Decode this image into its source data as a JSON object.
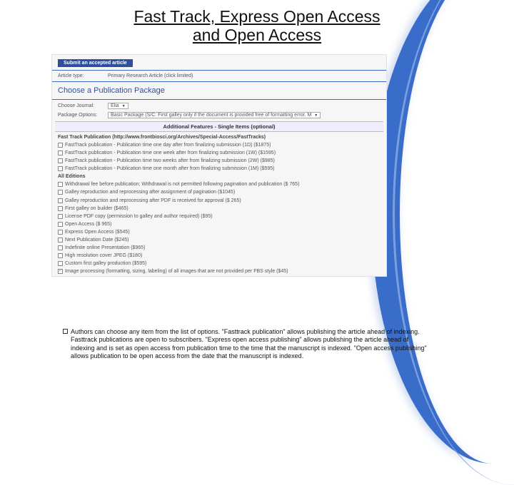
{
  "title_line1": "Fast Track, Express Open Access",
  "title_line2": "and Open Access",
  "panel": {
    "submit_label": "Submit an accepted article",
    "article_type_label": "Article type:",
    "article_type_value": "Primary Research Article (click limited)",
    "choose_package": "Choose a Publication Package",
    "choose_journal_label": "Choose Journal:",
    "choose_journal_value": "Elia",
    "package_options_label": "Package Options:",
    "package_options_value": "Basic Package (S/C: First galley only if the document is provided free of formatting error. M",
    "addl_header": "Additional Features - Single Items (optional)",
    "fast_track_header": "Fast Track Publication (http://www.frontbiosci.org/Archives/Special-Access/FastTracks)",
    "fast_track_items": [
      "FastTrack publication - Publication time one day after from finalizing submission (1D) ($1875)",
      "FastTrack publication - Publication time one week after from finalizing submission (1W) ($1595)",
      "FastTrack publication - Publication time two weeks after from finalizing submission (2W) ($985)",
      "FastTrack publication - Publication time one month after from finalizing submission (1M) ($595)"
    ],
    "all_editions_header": "All Editions",
    "edition_items": [
      "Withdrawal fee before publication; Withdrawal is not permitted following pagination and publication ($ 765)",
      "Galley reproduction and reprocessing after assignment of pagination ($1045)",
      "Galley reproduction and reprocessing after PDF is received for approval ($ 265)",
      "First galley on builder ($465)",
      "License PDF copy (permission to galley and author required) ($95)",
      "Open Access ($ 965)",
      "Express Open Access ($545)",
      "Next Publication Date ($245)",
      "Indefinite online Presentation ($965)",
      "High resolution cover JPEG ($180)",
      "Custom first galley production ($595)",
      "Image processing (formatting, sizing, labeling) of all images that are not provided per FBS style ($45)"
    ],
    "checked_indices": [
      11
    ]
  },
  "footnote": "Authors can choose any item from the list of options. \"Fasttrack publication\" allows publishing the article ahead of indexing. Fasttrack publications are open to subscribers. \"Express open access publishing\" allows publishing the article ahead of indexing and is set as open access from publication time to the time that the manuscript is indexed. \"Open access publishing\" allows publication to be open access from the date that the manuscript is indexed."
}
